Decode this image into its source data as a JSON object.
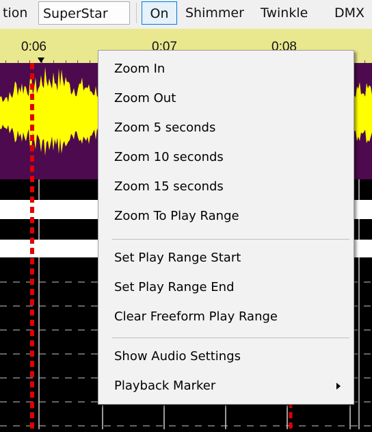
{
  "toolbar": {
    "items": [
      "tion",
      "SuperStar",
      "On",
      "Shimmer",
      "Twinkle",
      "DMX"
    ]
  },
  "ruler": {
    "labels": [
      "0:06",
      "0:07",
      "0:08"
    ]
  },
  "colors": {
    "ruler_bg": "#e9e88f",
    "waveform_bg": "#4e0a4f",
    "waveform_fill": "#ffff00",
    "play_marker": "#e00000",
    "menu_bg": "#f2f2f2"
  },
  "context_menu": {
    "items": [
      "Zoom In",
      "Zoom Out",
      "Zoom 5 seconds",
      "Zoom 10 seconds",
      "Zoom 15 seconds",
      "Zoom To Play Range",
      "Set Play Range Start",
      "Set Play Range End",
      "Clear Freeform Play Range",
      "Show Audio Settings",
      "Playback Marker"
    ],
    "submenu_icon": "submenu-arrow-icon"
  }
}
